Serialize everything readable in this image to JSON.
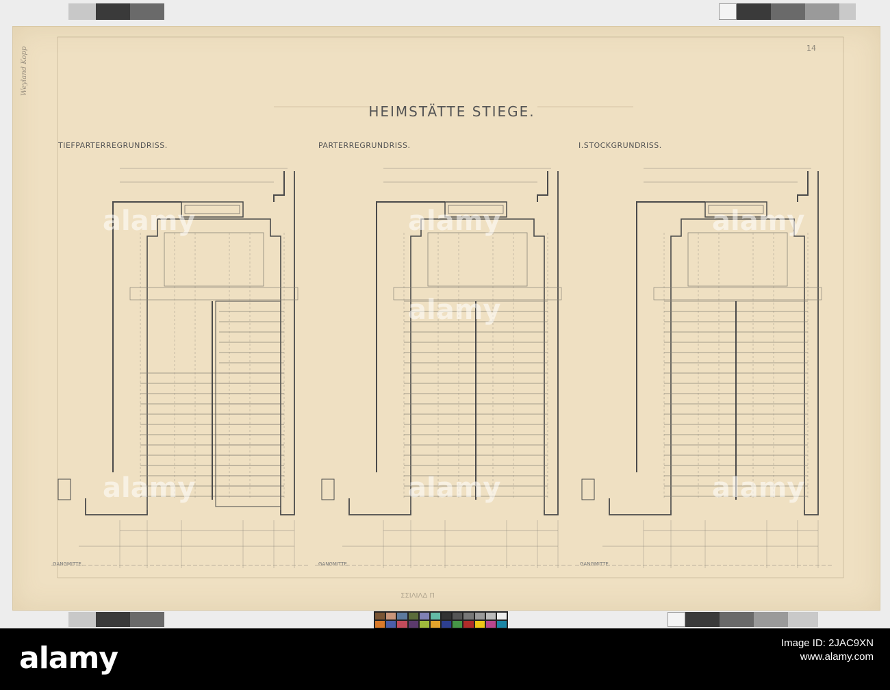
{
  "drawing": {
    "title": "HEIMSTÄTTE STIEGE.",
    "sheet_number": "14",
    "margin_note": "Weyland   Kopp",
    "bottom_stamp": "ΣΣΙΛΙΛΔ  Π",
    "plans": [
      {
        "label": "TIEFPARTERREGRUNDRISS.",
        "corridor_label": "GANGMITTE."
      },
      {
        "label": "PARTERREGRUNDRISS.",
        "corridor_label": "GANGMITTE."
      },
      {
        "label": "I.STOCKGRUNDRISS.",
        "corridor_label": "GANGMITTE."
      }
    ]
  },
  "watermark": {
    "brand": "alamy",
    "image_id_line": "Image ID: 2JAC9XN",
    "site_line": "www.alamy.com"
  },
  "colors": {
    "paper": "#efe0c2",
    "ink": "#4a4a4a",
    "pencil": "#8a8478",
    "footer": "#000000"
  }
}
